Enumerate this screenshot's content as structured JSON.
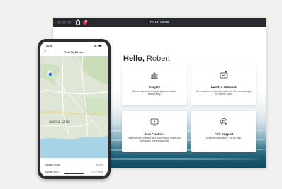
{
  "window": {
    "title": "POLY LENS"
  },
  "greeting": {
    "hello": "Hello,",
    "user": "Robert"
  },
  "cards": [
    {
      "title": "Insights",
      "desc": "Check your device usage and workstation connectivity.",
      "icon": "insights-chart-icon"
    },
    {
      "title": "Health & Wellness",
      "desc": "Set reminders to hydrate and rest. Play sounds apps to improve focus.",
      "icon": "health-wellness-icon"
    },
    {
      "title": "Best Practices",
      "desc": "Optimize your camera and learn how to make your workspace more ergonomic.",
      "icon": "best-practices-icon"
    },
    {
      "title": "Poly Support",
      "desc": "Experiencing issues? Let us help.",
      "icon": "poly-support-icon"
    }
  ],
  "phone": {
    "time": "10:01",
    "title": "Find My Device",
    "city": "Santa Cruz",
    "rows": [
      {
        "label": "Voyager Focus",
        "value": "Nearby"
      },
      {
        "label": "Voyager 6200",
        "value": "Out of range"
      }
    ]
  },
  "colors": {
    "titlebar": "#25282d",
    "ocean": "#1c5c74",
    "map_land": "#dfe6d6",
    "map_water": "#a7d3e6"
  }
}
